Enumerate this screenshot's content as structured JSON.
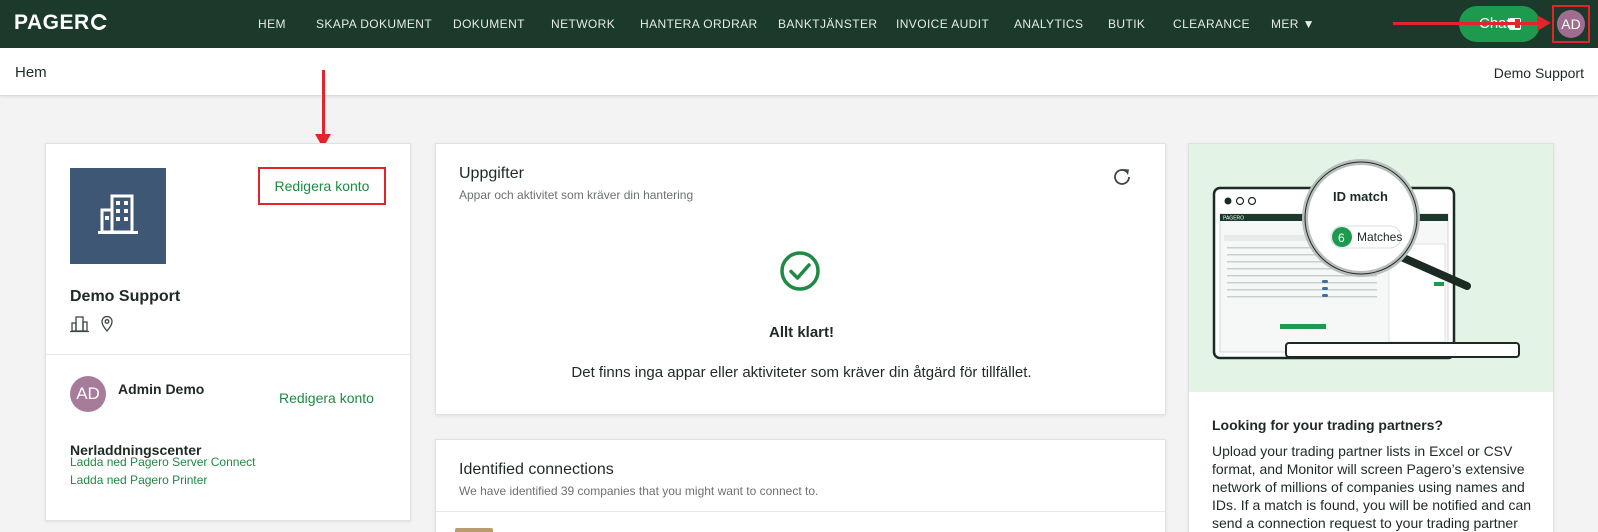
{
  "topnav": {
    "logo": "PAGER",
    "items": [
      {
        "label": "HEM"
      },
      {
        "label": "SKAPA DOKUMENT"
      },
      {
        "label": "DOKUMENT"
      },
      {
        "label": "NETWORK"
      },
      {
        "label": "HANTERA ORDRAR"
      },
      {
        "label": "BANKTJÄNSTER"
      },
      {
        "label": "INVOICE AUDIT"
      },
      {
        "label": "ANALYTICS"
      },
      {
        "label": "BUTIK"
      },
      {
        "label": "CLEARANCE"
      },
      {
        "label": "MER ▼"
      }
    ],
    "chat_label": "Chat",
    "avatar_initials": "AD"
  },
  "subheader": {
    "title": "Hem",
    "user": "Demo Support"
  },
  "account": {
    "edit_label": "Redigera konto",
    "org_name": "Demo Support",
    "user_initials": "AD",
    "user_name": "Admin Demo",
    "user_edit_label": "Redigera konto",
    "downloads_title": "Nerladdningscenter",
    "downloads": [
      {
        "label": "Ladda ned Pagero Server Connect"
      },
      {
        "label": "Ladda ned Pagero Printer"
      }
    ]
  },
  "tasks": {
    "title": "Uppgifter",
    "subtitle": "Appar och aktivitet som kräver din hantering",
    "status_title": "Allt klart!",
    "status_message": "Det finns inga appar eller aktiviteter som kräver din åtgärd för tillfället."
  },
  "connections": {
    "title": "Identified connections",
    "subtitle": "We have identified 39 companies that you might want to connect to."
  },
  "promo": {
    "illustration": {
      "logo": "PAGERO",
      "magnifier_title": "ID match",
      "match_count": "6",
      "match_label": "Matches"
    },
    "title": "Looking for your trading partners?",
    "text": "Upload your trading partner lists in Excel or CSV format, and Monitor will screen Pagero’s extensive network of millions of companies using names and IDs. If a match is found, you will be notified and can send a connection request to your trading partner with a single click."
  },
  "colors": {
    "nav_bg": "#1b3a2b",
    "accent_green": "#1e8a43",
    "annotation_red": "#e3242b",
    "org_logo_bg": "#3d5775",
    "avatar": "#a77c9b"
  }
}
